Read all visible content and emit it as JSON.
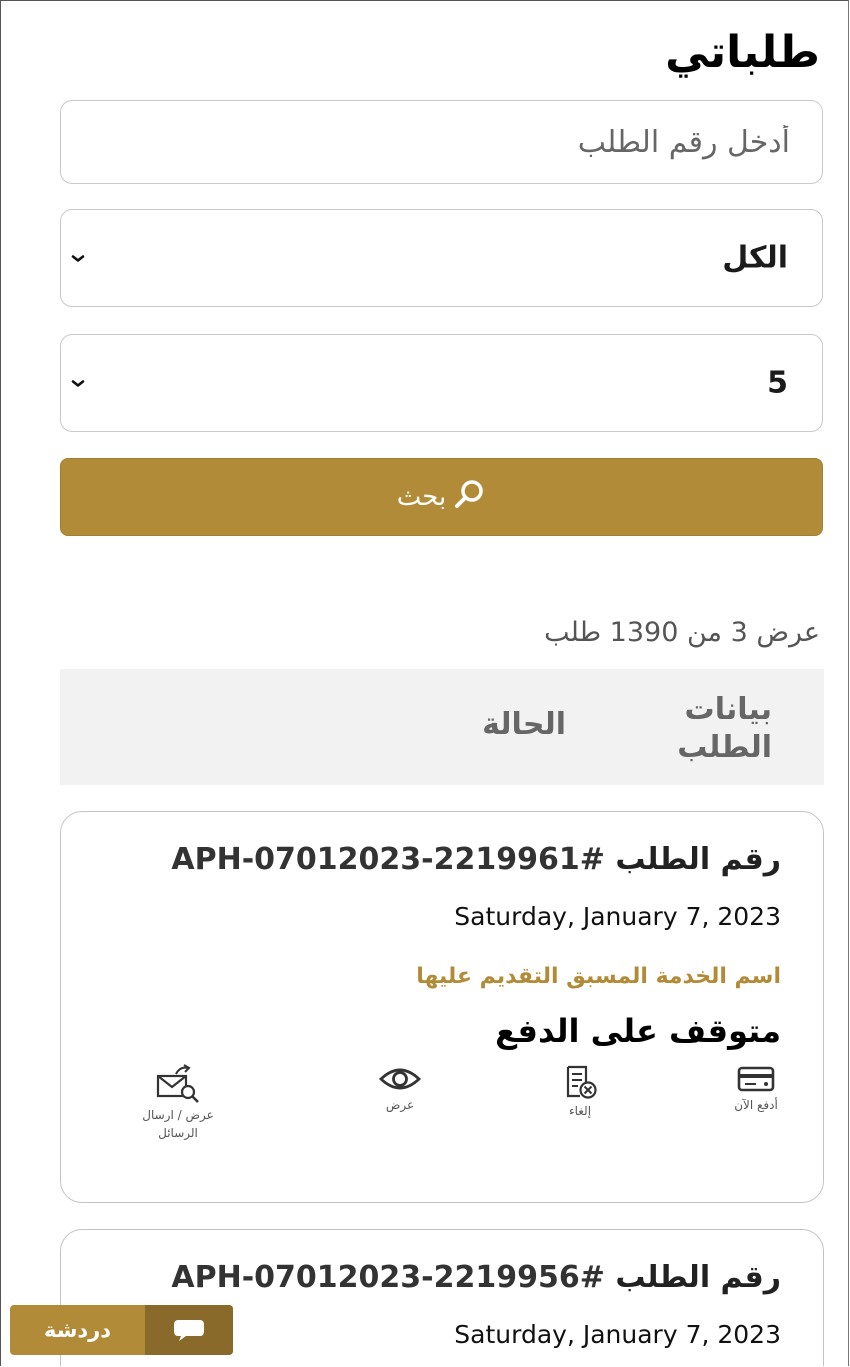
{
  "page": {
    "title": "طلباتي"
  },
  "search": {
    "placeholder": "أدخل رقم الطلب"
  },
  "filters": {
    "status_value": "الكل",
    "page_size_value": "5"
  },
  "search_button": {
    "label": "بحث",
    "icon": "search-icon"
  },
  "results": {
    "summary": "عرض 3 من 1390 طلب"
  },
  "table": {
    "headers": {
      "data": "بيانات الطلب",
      "status": "الحالة"
    }
  },
  "requests": [
    {
      "label": "رقم الطلب",
      "number": "#APH-07012023-2219961",
      "date": "Saturday, January 7, 2023",
      "service": "اسم الخدمة المسبق التقديم عليها",
      "status": "متوقف على الدفع",
      "actions": [
        {
          "label": "أدفع الآن",
          "icon": "credit-card-icon"
        },
        {
          "label": "إلغاء",
          "icon": "cancel-document-icon"
        },
        {
          "label": "عرض",
          "icon": "eye-icon"
        },
        {
          "label": "عرض / ارسال الرسائل",
          "icon": "messages-icon"
        }
      ]
    },
    {
      "label": "رقم الطلب",
      "number": "#APH-07012023-2219956",
      "date": "Saturday, January 7, 2023"
    }
  ],
  "chat": {
    "label": "دردشة",
    "icon": "chat-bubble-icon"
  },
  "colors": {
    "accent": "#b28b38",
    "accent_dark": "#8a6a2a",
    "header_bg": "#f2f2f2"
  }
}
